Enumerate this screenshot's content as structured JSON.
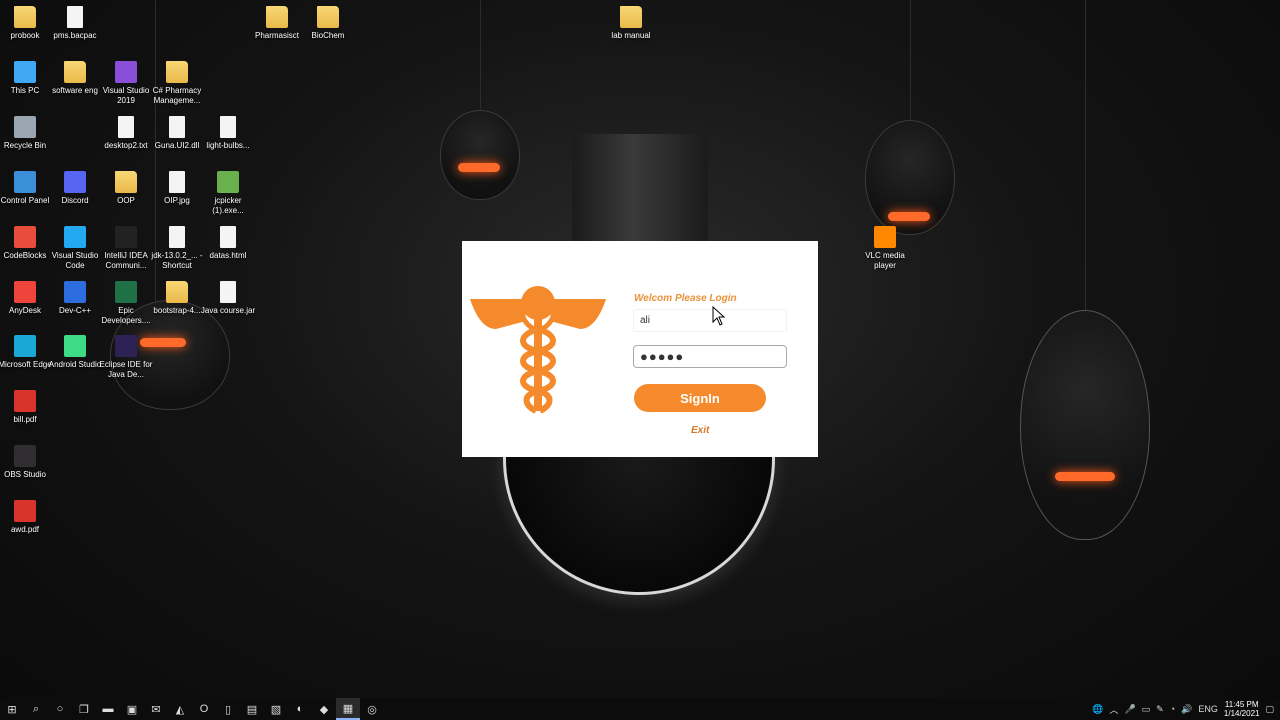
{
  "desktop_icons": [
    {
      "label": "probook",
      "icon": "user-folder-icon",
      "type": "folder"
    },
    {
      "label": "pms.bacpac",
      "icon": "file-icon",
      "type": "file"
    },
    {
      "label": "Pharmasisct",
      "icon": "folder-icon",
      "type": "folder"
    },
    {
      "label": "BioChem",
      "icon": "folder-icon",
      "type": "folder"
    },
    {
      "label": "lab manual",
      "icon": "folder-icon",
      "type": "folder"
    },
    {
      "label": "This PC",
      "icon": "computer-icon",
      "type": "app",
      "color": "#3fa9f5"
    },
    {
      "label": "software eng",
      "icon": "folder-icon",
      "type": "folder"
    },
    {
      "label": "Visual Studio 2019",
      "icon": "visual-studio-icon",
      "type": "app",
      "color": "#8a4fd8"
    },
    {
      "label": "C# Pharmacy Manageme...",
      "icon": "folder-icon",
      "type": "folder"
    },
    {
      "label": "Recycle Bin",
      "icon": "recycle-bin-icon",
      "type": "app",
      "color": "#9aa7b3"
    },
    {
      "label": "desktop2.txt",
      "icon": "text-file-icon",
      "type": "file"
    },
    {
      "label": "Guna.UI2.dll",
      "icon": "dll-file-icon",
      "type": "file"
    },
    {
      "label": "light-bulbs...",
      "icon": "image-file-icon",
      "type": "file"
    },
    {
      "label": "Control Panel",
      "icon": "control-panel-icon",
      "type": "app",
      "color": "#3a8fd8"
    },
    {
      "label": "Discord",
      "icon": "discord-icon",
      "type": "app",
      "color": "#5865f2"
    },
    {
      "label": "OOP",
      "icon": "folder-icon",
      "type": "folder"
    },
    {
      "label": "OIP.jpg",
      "icon": "image-file-icon",
      "type": "file"
    },
    {
      "label": "jcpicker (1).exe...",
      "icon": "jcpicker-icon",
      "type": "app",
      "color": "#6ab04c"
    },
    {
      "label": "CodeBlocks",
      "icon": "codeblocks-icon",
      "type": "app",
      "color": "#e74c3c"
    },
    {
      "label": "Visual Studio Code",
      "icon": "vscode-icon",
      "type": "app",
      "color": "#23a9f2"
    },
    {
      "label": "IntelliJ IDEA Communi...",
      "icon": "intellij-icon",
      "type": "app",
      "color": "#222222"
    },
    {
      "label": "jdk-13.0.2_... - Shortcut",
      "icon": "file-icon",
      "type": "file"
    },
    {
      "label": "datas.html",
      "icon": "html-file-icon",
      "type": "file"
    },
    {
      "label": "AnyDesk",
      "icon": "anydesk-icon",
      "type": "app",
      "color": "#ef443b"
    },
    {
      "label": "Dev-C++",
      "icon": "devcpp-icon",
      "type": "app",
      "color": "#2d6cdf"
    },
    {
      "label": "Epic Developers....",
      "icon": "excel-file-icon",
      "type": "app",
      "color": "#1e7145"
    },
    {
      "label": "bootstrap-4...",
      "icon": "folder-icon",
      "type": "folder"
    },
    {
      "label": "Java course.jar",
      "icon": "java-icon",
      "type": "file"
    },
    {
      "label": "Microsoft Edge",
      "icon": "edge-icon",
      "type": "app",
      "color": "#1ba8d6"
    },
    {
      "label": "Android Studio",
      "icon": "android-studio-icon",
      "type": "app",
      "color": "#3ddc84"
    },
    {
      "label": "Eclipse IDE for Java De...",
      "icon": "eclipse-icon",
      "type": "app",
      "color": "#2c2255"
    },
    {
      "label": "bill.pdf",
      "icon": "pdf-icon",
      "type": "app",
      "color": "#d9342b"
    },
    {
      "label": "OBS Studio",
      "icon": "obs-icon",
      "type": "app",
      "color": "#302e31"
    },
    {
      "label": "awd.pdf",
      "icon": "pdf-icon",
      "type": "app",
      "color": "#d9342b"
    },
    {
      "label": "VLC media player",
      "icon": "vlc-icon",
      "type": "app",
      "color": "#ff8800"
    }
  ],
  "login": {
    "welcome": "Welcom Please Login",
    "username_value": "ali",
    "password_value": "●●●●●",
    "signin_label": "SignIn",
    "exit_label": "Exit",
    "accent_color": "#f58a2c"
  },
  "taskbar": {
    "items": [
      "windows-start-icon",
      "search-icon",
      "cortana-icon",
      "task-view-icon",
      "file-explorer-icon",
      "store-icon",
      "mail-icon",
      "android-studio-icon",
      "opera-icon",
      "file-icon",
      "remote-icon",
      "photos-icon",
      "edge-icon",
      "visual-studio-icon",
      "pharmacy-app-icon",
      "obs-icon"
    ],
    "time": "11:45 PM",
    "date": "1/14/2021"
  }
}
